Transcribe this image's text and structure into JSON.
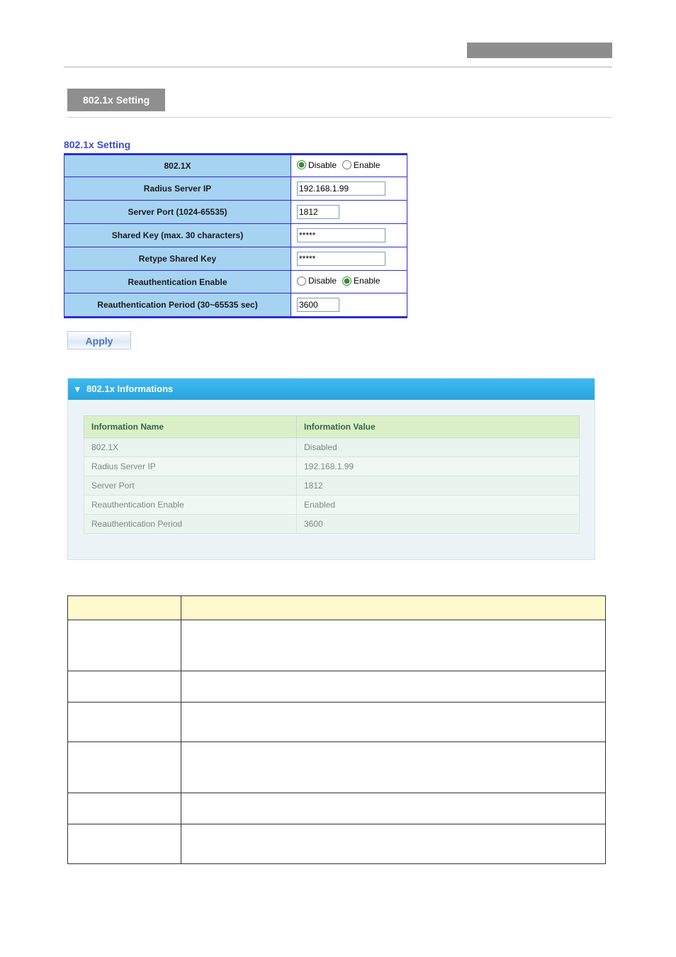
{
  "tab_title": "802.1x Setting",
  "settings_title": "802.1x Setting",
  "settings": {
    "rows": [
      {
        "label": "802.1X",
        "type": "radio",
        "disable": "Disable",
        "enable": "Enable",
        "selected": "disable"
      },
      {
        "label": "Radius Server IP",
        "type": "text",
        "value": "192.168.1.99"
      },
      {
        "label": "Server Port (1024-65535)",
        "type": "text_short",
        "value": "1812"
      },
      {
        "label": "Shared Key (max. 30 characters)",
        "type": "password",
        "value": "*****"
      },
      {
        "label": "Retype Shared Key",
        "type": "password",
        "value": "*****"
      },
      {
        "label": "Reauthentication Enable",
        "type": "radio",
        "disable": "Disable",
        "enable": "Enable",
        "selected": "enable"
      },
      {
        "label": "Reauthentication Period (30~65535 sec)",
        "type": "text_short",
        "value": "3600"
      }
    ]
  },
  "apply_label": "Apply",
  "info_header": "802.1x Informations",
  "info_columns": {
    "name": "Information Name",
    "value": "Information Value"
  },
  "info_rows": [
    {
      "name": "802.1X",
      "value": "Disabled"
    },
    {
      "name": "Radius Server IP",
      "value": "192.168.1.99"
    },
    {
      "name": "Server Port",
      "value": "1812"
    },
    {
      "name": "Reauthentication Enable",
      "value": "Enabled"
    },
    {
      "name": "Reauthentication Period",
      "value": "3600"
    }
  ],
  "desc_rows_heights": [
    26,
    72,
    44,
    56,
    72,
    44,
    56
  ]
}
